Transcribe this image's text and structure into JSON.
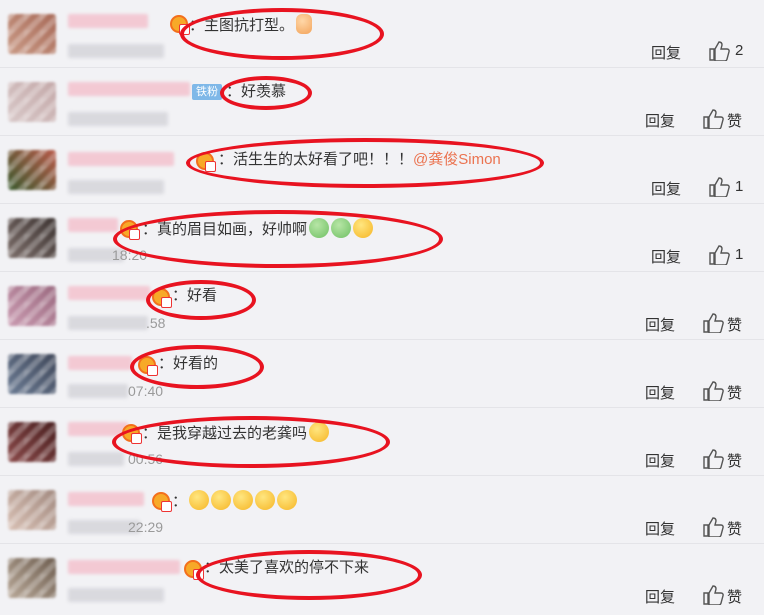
{
  "comments": [
    {
      "text": "：主图抗打型。",
      "emoji": [
        "thumb"
      ],
      "reply": "回复",
      "likes": "2"
    },
    {
      "badge": "铁粉",
      "text": "：好羡慕",
      "time": "6月1日 18:28",
      "reply": "回复",
      "likes": "赞"
    },
    {
      "text": "：活生生的太好看了吧！！！",
      "mention": "@龚俊Simon",
      "reply": "回复",
      "likes": "1"
    },
    {
      "text": "：真的眉目如画，好帅啊",
      "emoji": [
        "green",
        "green",
        "face"
      ],
      "time": "18:20",
      "reply": "回复",
      "likes": "1"
    },
    {
      "text": "：好看",
      "time": ".58",
      "reply": "回复",
      "likes": "赞"
    },
    {
      "text": "：好看的",
      "time": "07:40",
      "reply": "回复",
      "likes": "赞"
    },
    {
      "text": "：是我穿越过去的老龚吗",
      "emoji": [
        "face"
      ],
      "time": "00:56",
      "reply": "回复",
      "likes": "赞"
    },
    {
      "text": "：",
      "emoji": [
        "face",
        "face",
        "face",
        "face",
        "face"
      ],
      "time": "22:29",
      "reply": "回复",
      "likes": "赞"
    },
    {
      "text": "：太美了喜欢的停不下来",
      "reply": "回复",
      "likes": "赞"
    }
  ],
  "colors": {
    "highlight": "#e81320",
    "mention": "#eb7350",
    "background": "#f2f2f5"
  }
}
